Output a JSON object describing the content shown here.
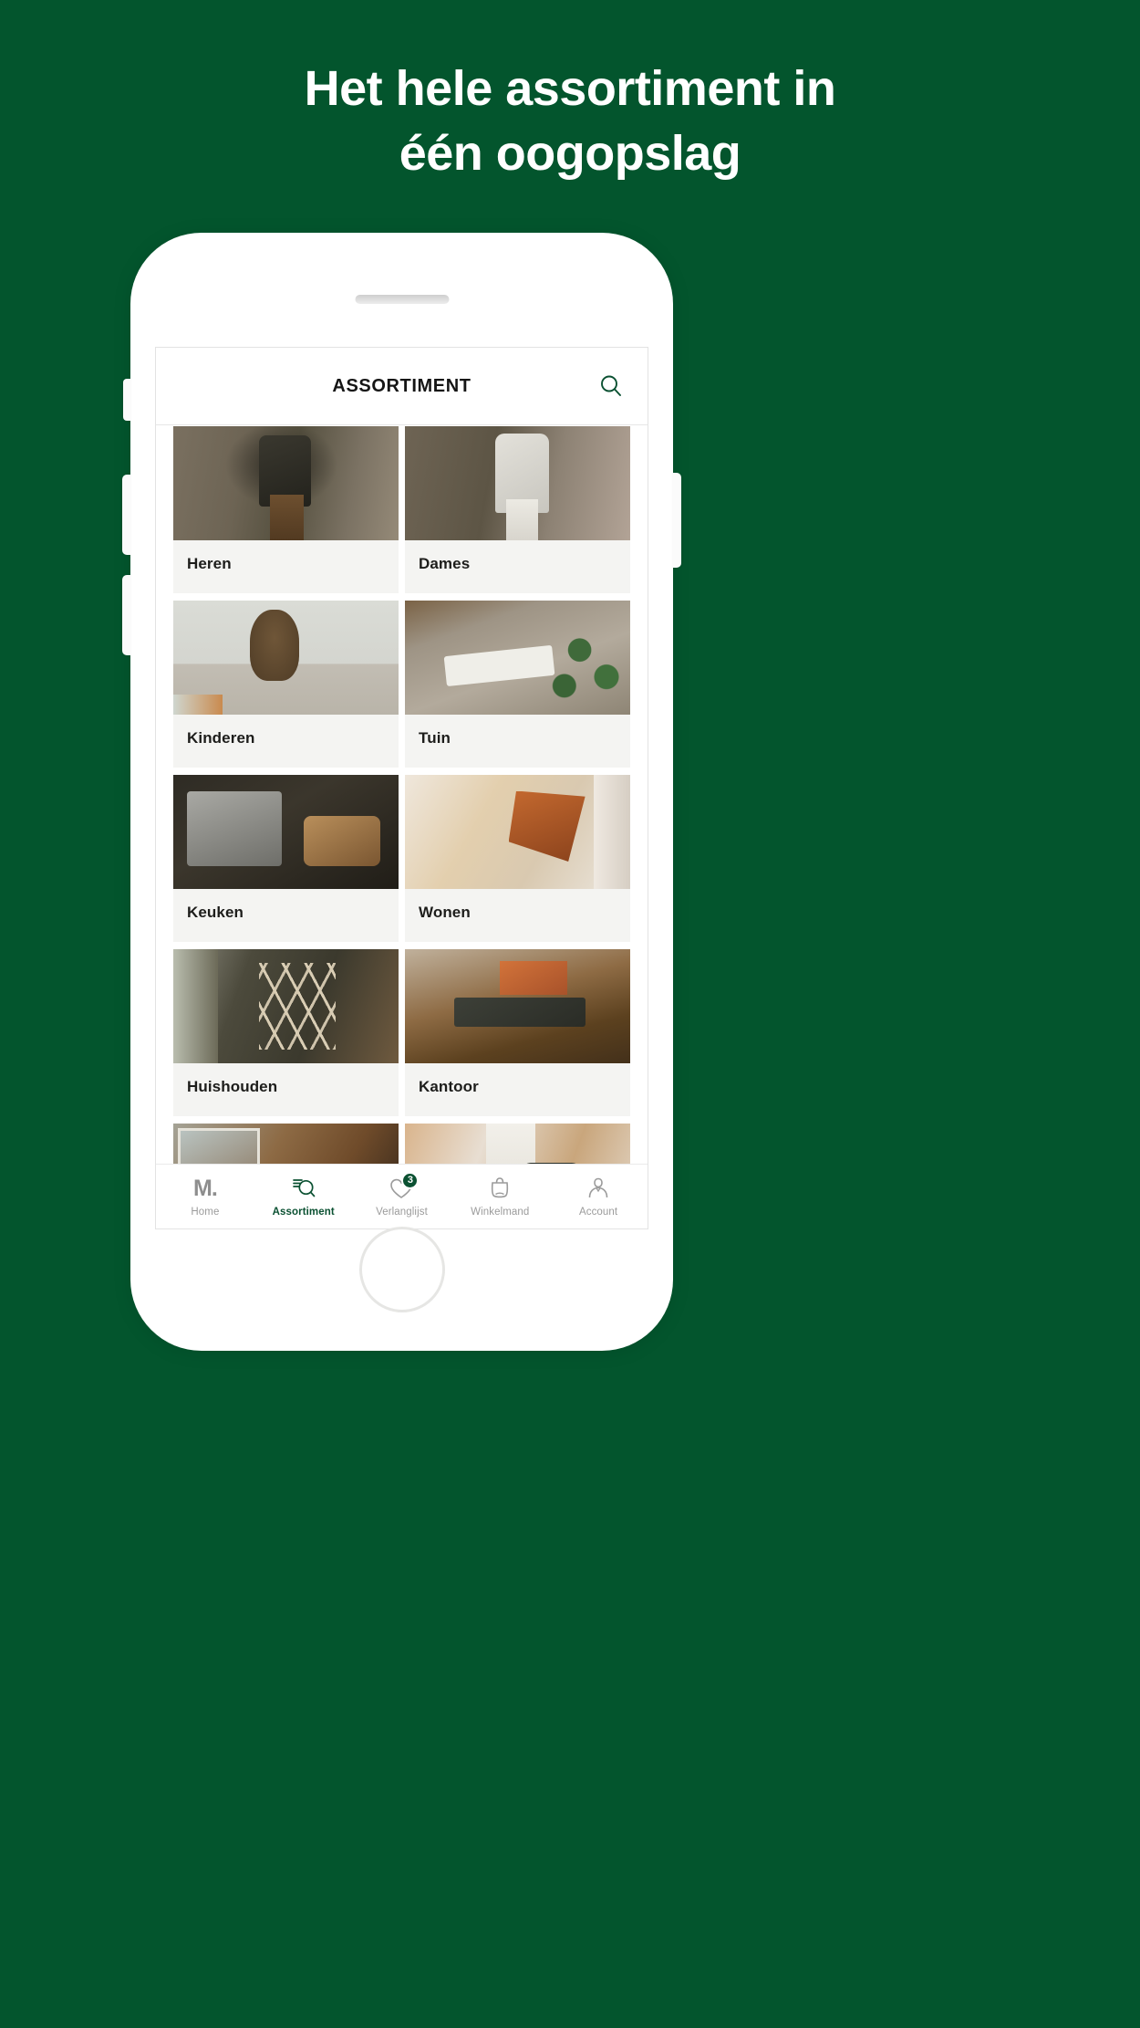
{
  "theme": {
    "background_green": "#03552d",
    "accent_green": "#0b5132",
    "tile_bg": "#f4f4f2",
    "text_dark": "#1d1d1b",
    "text_muted": "#9b9b9b"
  },
  "headline": {
    "line1": "Het hele assortiment in",
    "line2": "één oogopslag"
  },
  "app": {
    "header": {
      "title": "ASSORTIMENT",
      "search_icon": "search-icon"
    },
    "categories": [
      {
        "label": "Heren",
        "image": "man-in-jacket-photo"
      },
      {
        "label": "Dames",
        "image": "woman-in-coat-photo"
      },
      {
        "label": "Kinderen",
        "image": "teddy-bear-photo"
      },
      {
        "label": "Tuin",
        "image": "garden-tools-photo"
      },
      {
        "label": "Keuken",
        "image": "panini-grill-photo"
      },
      {
        "label": "Wonen",
        "image": "butterfly-chair-photo"
      },
      {
        "label": "Huishouden",
        "image": "drying-rack-photo"
      },
      {
        "label": "Kantoor",
        "image": "desk-lamp-photo"
      },
      {
        "label": "",
        "image": "interior-photo-partial"
      },
      {
        "label": "",
        "image": "bag-photo-partial"
      }
    ],
    "bottom_nav": [
      {
        "label": "Home",
        "icon": "m-logo-icon",
        "active": false,
        "badge": ""
      },
      {
        "label": "Assortiment",
        "icon": "list-search-icon",
        "active": true,
        "badge": ""
      },
      {
        "label": "Verlanglijst",
        "icon": "heart-icon",
        "active": false,
        "badge": "3"
      },
      {
        "label": "Winkelmand",
        "icon": "shopping-bag-icon",
        "active": false,
        "badge": ""
      },
      {
        "label": "Account",
        "icon": "person-icon",
        "active": false,
        "badge": ""
      }
    ]
  },
  "device": {
    "speaker": "speaker-grille",
    "home_button": "home-button",
    "silent_switch": "silent-switch",
    "volume_up": "volume-up-button",
    "volume_down": "volume-down-button",
    "power": "power-button"
  }
}
